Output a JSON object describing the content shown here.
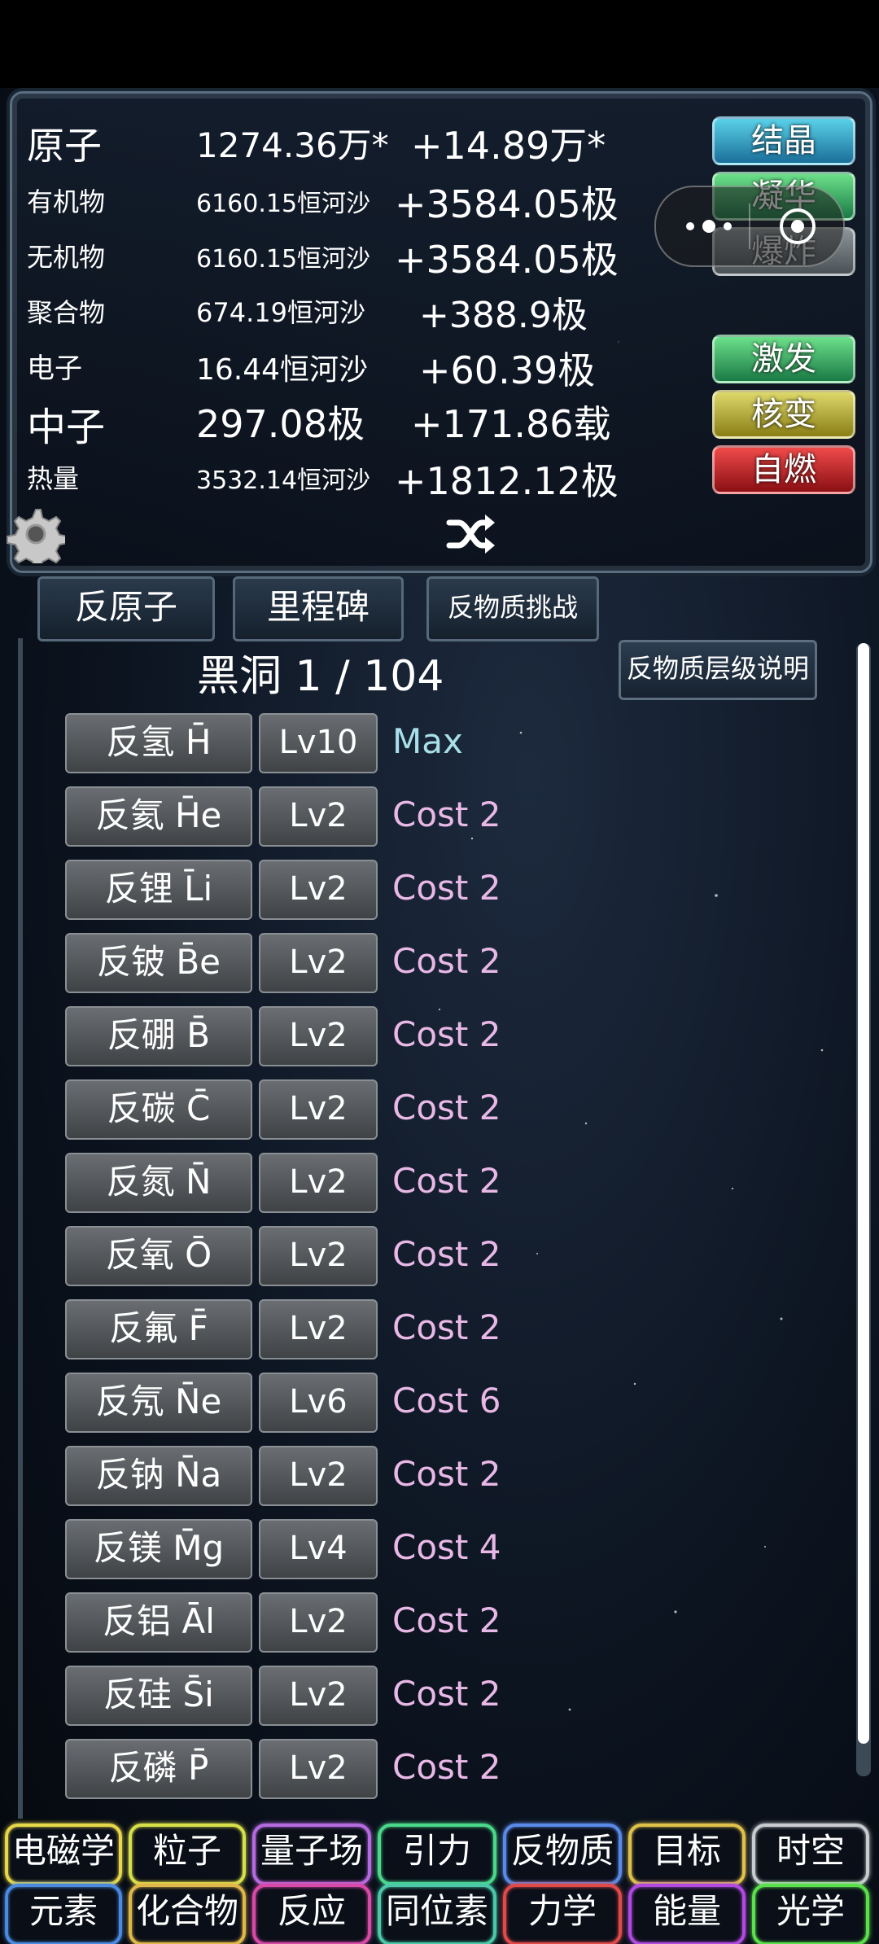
{
  "resources": [
    {
      "name": "原子",
      "amount": "1274.36万*",
      "rate": "+14.89万*",
      "size": "big"
    },
    {
      "name": "有机物",
      "amount": "6160.15恒河沙",
      "rate": "+3584.05极",
      "size": "sm"
    },
    {
      "name": "无机物",
      "amount": "6160.15恒河沙",
      "rate": "+3584.05极",
      "size": "sm"
    },
    {
      "name": "聚合物",
      "amount": "674.19恒河沙",
      "rate": "+388.9极",
      "size": "sm"
    },
    {
      "name": "电子",
      "amount": "16.44恒河沙",
      "rate": "+60.39极",
      "size": "mid"
    },
    {
      "name": "中子",
      "amount": "297.08极",
      "rate": "+171.86载",
      "size": "big"
    },
    {
      "name": "热量",
      "amount": "3532.14恒河沙",
      "rate": "+1812.12极",
      "size": "sm"
    }
  ],
  "actions": {
    "crystal": "结晶",
    "condense": "凝华",
    "explode": "爆炸",
    "excite": "激发",
    "fission": "核变",
    "ignite": "自燃"
  },
  "tabs": [
    "反原子",
    "里程碑",
    "反物质挑战"
  ],
  "panel": {
    "title": "黑洞 1 / 104",
    "info_button": "反物质层级说明"
  },
  "items": [
    {
      "name": "反氢 H̄",
      "level": "Lv10",
      "cost": "Max"
    },
    {
      "name": "反氦 H̄e",
      "level": "Lv2",
      "cost": "Cost 2"
    },
    {
      "name": "反锂 L̄i",
      "level": "Lv2",
      "cost": "Cost 2"
    },
    {
      "name": "反铍 B̄e",
      "level": "Lv2",
      "cost": "Cost 2"
    },
    {
      "name": "反硼 B̄",
      "level": "Lv2",
      "cost": "Cost 2"
    },
    {
      "name": "反碳 C̄",
      "level": "Lv2",
      "cost": "Cost 2"
    },
    {
      "name": "反氮 N̄",
      "level": "Lv2",
      "cost": "Cost 2"
    },
    {
      "name": "反氧 Ō",
      "level": "Lv2",
      "cost": "Cost 2"
    },
    {
      "name": "反氟 F̄",
      "level": "Lv2",
      "cost": "Cost 2"
    },
    {
      "name": "反氖 N̄e",
      "level": "Lv6",
      "cost": "Cost 6"
    },
    {
      "name": "反钠 N̄a",
      "level": "Lv2",
      "cost": "Cost 2"
    },
    {
      "name": "反镁 M̄g",
      "level": "Lv4",
      "cost": "Cost 4"
    },
    {
      "name": "反铝 Āl",
      "level": "Lv2",
      "cost": "Cost 2"
    },
    {
      "name": "反硅 S̄i",
      "level": "Lv2",
      "cost": "Cost 2"
    },
    {
      "name": "反磷 P̄",
      "level": "Lv2",
      "cost": "Cost 2"
    }
  ],
  "nav_row1": [
    {
      "label": "电磁学",
      "color": "#e6d84a"
    },
    {
      "label": "粒子",
      "color": "#d8e04a"
    },
    {
      "label": "量子场",
      "color": "#b56be0"
    },
    {
      "label": "引力",
      "color": "#4ad88a"
    },
    {
      "label": "反物质",
      "color": "#5a8ae8"
    },
    {
      "label": "目标",
      "color": "#e0c24a"
    },
    {
      "label": "时空",
      "color": "#c8ccd0"
    }
  ],
  "nav_row2": [
    {
      "label": "元素",
      "color": "#4a8ae0"
    },
    {
      "label": "化合物",
      "color": "#e0b84a"
    },
    {
      "label": "反应",
      "color": "#d84aa8"
    },
    {
      "label": "同位素",
      "color": "#4ac8a8"
    },
    {
      "label": "力学",
      "color": "#e04a4a"
    },
    {
      "label": "能量",
      "color": "#b04ae0"
    },
    {
      "label": "光学",
      "color": "#5ae04a"
    }
  ]
}
